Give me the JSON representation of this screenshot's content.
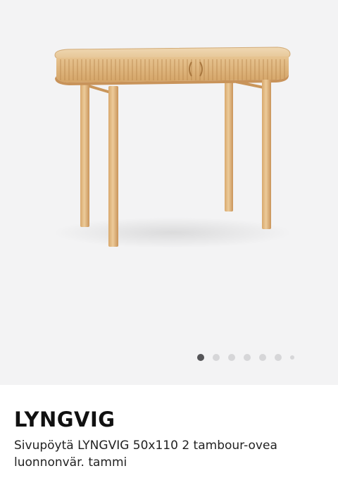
{
  "product": {
    "name": "LYNGVIG",
    "description": "Sivupöytä LYNGVIG 50x110 2 tambour-ovea luonnonvär. tammi"
  },
  "gallery": {
    "dot_count": 7,
    "active_index": 0
  },
  "colors": {
    "image_background": "#f3f3f4",
    "wood_light": "#e9cba0",
    "wood_mid": "#d9ad72",
    "wood_dark": "#b8864c",
    "dot_active": "#555558",
    "dot_inactive": "#d6d6d8"
  }
}
